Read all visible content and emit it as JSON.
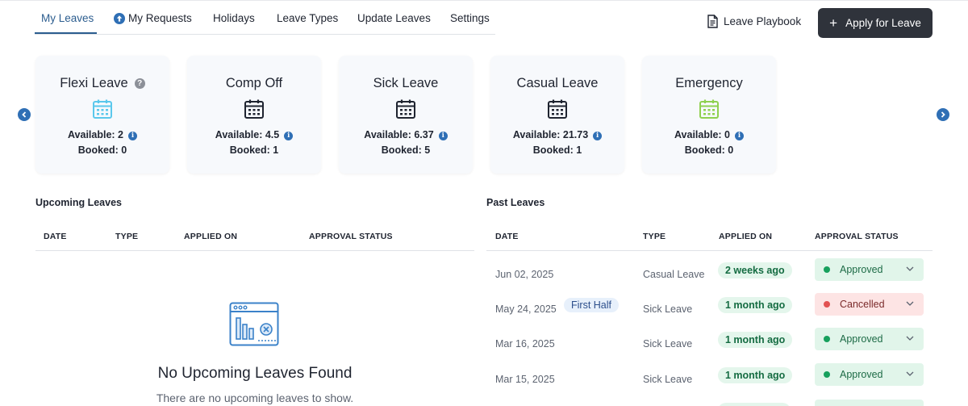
{
  "tabs": [
    {
      "label": "My Leaves",
      "active": true
    },
    {
      "label": "My Requests",
      "icon": "arrow-up-circle-icon"
    },
    {
      "label": "Holidays"
    },
    {
      "label": "Leave Types"
    },
    {
      "label": "Update Leaves"
    },
    {
      "label": "Settings"
    }
  ],
  "header": {
    "playbook_label": "Leave Playbook",
    "apply_label": "Apply for Leave",
    "accent": "#2c5d8f",
    "button_bg": "#2f333b"
  },
  "cards": [
    {
      "title": "Flexi Leave",
      "available": "Available: 2",
      "booked": "Booked: 0",
      "icon_color": "#5bc8ec",
      "has_help": true
    },
    {
      "title": "Comp Off",
      "available": "Available: 4.5",
      "booked": "Booked: 1",
      "icon_color": "#1f2430"
    },
    {
      "title": "Sick Leave",
      "available": "Available: 6.37",
      "booked": "Booked: 5",
      "icon_color": "#1f2430"
    },
    {
      "title": "Casual Leave",
      "available": "Available: 21.73",
      "booked": "Booked: 1",
      "icon_color": "#1f2430"
    },
    {
      "title": "Emergency",
      "available": "Available: 0",
      "booked": "Booked: 0",
      "icon_color": "#8fd14f"
    }
  ],
  "upcoming": {
    "title": "Upcoming Leaves",
    "columns": [
      "DATE",
      "TYPE",
      "APPLIED ON",
      "APPROVAL STATUS"
    ],
    "empty_title": "No Upcoming Leaves Found",
    "empty_text": "There are no upcoming leaves to show."
  },
  "past": {
    "title": "Past Leaves",
    "columns": [
      "DATE",
      "TYPE",
      "APPLIED ON",
      "APPROVAL STATUS"
    ],
    "rows": [
      {
        "date": "Jun 02, 2025",
        "half": "",
        "type": "Casual Leave",
        "applied": "2 weeks ago",
        "status": "Approved",
        "status_kind": "approved"
      },
      {
        "date": "May 24, 2025",
        "half": "First Half",
        "type": "Sick Leave",
        "applied": "1 month ago",
        "status": "Cancelled",
        "status_kind": "cancelled"
      },
      {
        "date": "Mar 16, 2025",
        "half": "",
        "type": "Sick Leave",
        "applied": "1 month ago",
        "status": "Approved",
        "status_kind": "approved"
      },
      {
        "date": "Mar 15, 2025",
        "half": "",
        "type": "Sick Leave",
        "applied": "1 month ago",
        "status": "Approved",
        "status_kind": "approved"
      }
    ]
  }
}
